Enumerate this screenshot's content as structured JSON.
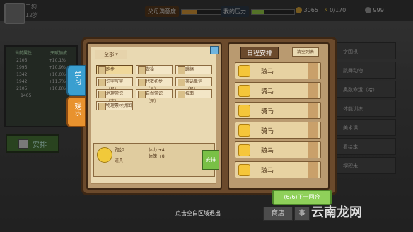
{
  "topbar": {
    "player_name": "二狗",
    "player_age": "12岁",
    "parent_satisfaction_label": "父母满意度",
    "parent_satisfaction_level": 0.35,
    "my_pressure_label": "我的压力",
    "my_pressure_level": 0.3,
    "money": "3065",
    "energy": "0/170",
    "gems": "999"
  },
  "left_panel": {
    "headers": [
      "当前属性",
      "天赋加成"
    ],
    "rows": [
      {
        "a": "2105",
        "b": "+10.1%"
      },
      {
        "a": "1995",
        "b": "+10.9%"
      },
      {
        "a": "1342",
        "b": "+10.0%"
      },
      {
        "a": "1942",
        "b": "+11.7%"
      },
      {
        "a": "2105",
        "b": "+10.8%"
      },
      {
        "a": "1405",
        "b": ""
      }
    ],
    "arrange_label": "安排"
  },
  "tabs": {
    "study": "学习",
    "entertainment": "娱乐"
  },
  "activities": {
    "filter_label": "全部",
    "items": [
      {
        "label": "跑步",
        "selected": true
      },
      {
        "label": "做操",
        "selected": false
      },
      {
        "label": "跳绳",
        "selected": false
      },
      {
        "label": "识字写字（易）",
        "selected": false
      },
      {
        "label": "代数初步（易）",
        "selected": false
      },
      {
        "label": "英语单词（易）",
        "selected": false
      },
      {
        "label": "地理常识（文）",
        "selected": false
      },
      {
        "label": "自然常识（理）",
        "selected": false
      },
      {
        "label": "拉面",
        "selected": false
      },
      {
        "label": "物理素材拼图",
        "selected": false
      }
    ]
  },
  "detail": {
    "name": "跑步",
    "sub": "道具",
    "stat1": "体力 +4",
    "stat2": "体魄 +8",
    "arrange_label": "安排"
  },
  "plan": {
    "title": "日程安排",
    "clear_label": "清空列表",
    "slots": [
      "骑马",
      "骑马",
      "骑马",
      "骑马",
      "骑马",
      "骑马"
    ]
  },
  "right_list": {
    "items": [
      "学围棋",
      "跳舞动物",
      "奥数命运（哈）",
      "体能训练",
      "美术课",
      "看绘本",
      "摆积木"
    ]
  },
  "next_button": "(6/6)下一回合",
  "hint": "点击空白区域退出",
  "bottom": {
    "shop": "商店",
    "events": "事"
  },
  "watermark": "云南龙网"
}
